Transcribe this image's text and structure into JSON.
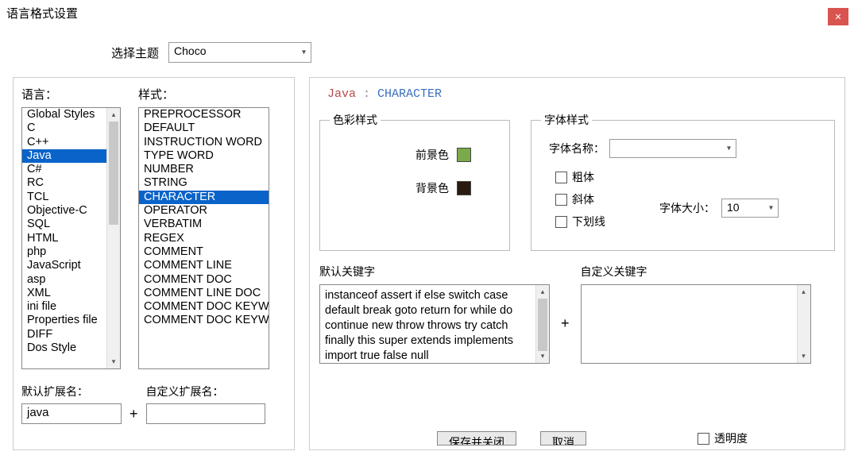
{
  "window": {
    "title": "语言格式设置"
  },
  "theme": {
    "label": "选择主题",
    "value": "Choco"
  },
  "left": {
    "lang_label": "语言：",
    "style_label": "样式：",
    "languages": [
      "Global Styles",
      "C",
      "C++",
      "Java",
      "C#",
      "RC",
      "TCL",
      "Objective-C",
      "SQL",
      "HTML",
      "php",
      "JavaScript",
      "asp",
      "XML",
      "ini file",
      "Properties file",
      "DIFF",
      "Dos Style"
    ],
    "selected_language_index": 3,
    "styles": [
      "PREPROCESSOR",
      "DEFAULT",
      "INSTRUCTION WORD",
      "TYPE WORD",
      "NUMBER",
      "STRING",
      "CHARACTER",
      "OPERATOR",
      "VERBATIM",
      "REGEX",
      "COMMENT",
      "COMMENT LINE",
      "COMMENT DOC",
      "COMMENT LINE DOC",
      "COMMENT DOC KEYWORD",
      "COMMENT DOC KEYWORD ERROR"
    ],
    "selected_style_index": 6,
    "default_ext_label": "默认扩展名：",
    "default_ext_value": "java",
    "custom_ext_label": "自定义扩展名：",
    "custom_ext_value": ""
  },
  "right": {
    "header_lang": "Java",
    "header_sep": " : ",
    "header_style": "CHARACTER",
    "color_legend": "色彩样式",
    "fg_label": "前景色",
    "fg_color": "#7aaa4a",
    "bg_label": "背景色",
    "bg_color": "#2a1a10",
    "font_legend": "字体样式",
    "font_name_label": "字体名称：",
    "font_name_value": "",
    "bold_label": "粗体",
    "italic_label": "斜体",
    "underline_label": "下划线",
    "font_size_label": "字体大小：",
    "font_size_value": "10",
    "default_kw_label": "默认关键字",
    "default_kw_value": "instanceof assert if else switch case default break goto return for while do continue new throw throws try catch finally this super extends implements import true false null",
    "custom_kw_label": "自定义关键字",
    "custom_kw_value": ""
  },
  "buttons": {
    "save_close": "保存并关闭",
    "cancel": "取消",
    "transparency": "透明度"
  }
}
